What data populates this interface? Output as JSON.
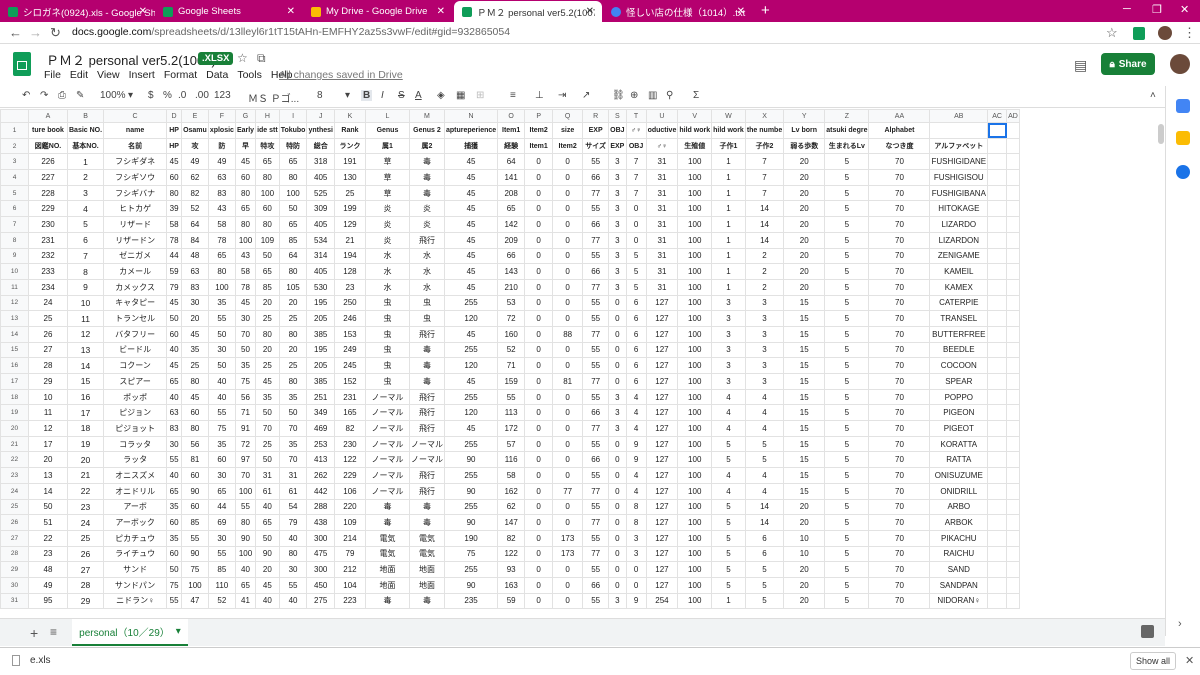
{
  "browser": {
    "tabs": [
      {
        "title": "シロガネ(0924).xls - Google Sheets",
        "fav": "#0f9d58"
      },
      {
        "title": "Google Sheets",
        "fav": "#0f9d58"
      },
      {
        "title": "My Drive - Google Drive",
        "fav": "#fbbc04"
      },
      {
        "title": "ＰＭ２ personal ver5.2(1007).xlsx",
        "fav": "#0f9d58"
      },
      {
        "title": "怪しい店の仕様（1014）.txt",
        "fav": "#4285f4"
      }
    ],
    "url_host": "docs.google.com",
    "url_path": "/spreadsheets/d/13lleyl6r1tT15tAHn-EMFHY2az5s3vwF/edit#gid=932865054"
  },
  "doc": {
    "title": "ＰＭ２ personal ver5.2(1007)",
    "badge": ".XLSX",
    "menu": [
      "File",
      "Edit",
      "View",
      "Insert",
      "Format",
      "Data",
      "Tools",
      "Help"
    ],
    "saved": "All changes saved in Drive",
    "share": "Share"
  },
  "toolbar": {
    "zoom": "100%",
    "currency": "$",
    "percent": "%",
    "dec_less": ".0",
    "dec_more": ".00",
    "format": "123",
    "font": "ＭＳ Ｐゴ...",
    "size": "8",
    "bold": "B",
    "italic": "I",
    "strike": "S",
    "textcolor": "A"
  },
  "grid": {
    "columns": [
      "A",
      "B",
      "C",
      "D",
      "E",
      "F",
      "G",
      "H",
      "I",
      "J",
      "K",
      "L",
      "M",
      "N",
      "O",
      "P",
      "Q",
      "R",
      "S",
      "T",
      "U",
      "V",
      "W",
      "X",
      "Y",
      "Z",
      "AA",
      "AB",
      "AC",
      "AD"
    ],
    "header1": [
      "ture book",
      "Basic NO.",
      "name",
      "HP",
      "Osamu",
      "xplosic",
      "Early",
      "ide stt",
      "Tokubo",
      "ynthesi",
      "Rank",
      "Genus",
      "Genus 2",
      "aptureperience",
      "Item1",
      "Item2",
      "size",
      "EXP",
      "OBJ",
      "♂♀",
      "oductive",
      "hild work",
      "hild work",
      "the numbe",
      "Lv born",
      "atsuki degre",
      "Alphabet",
      "",
      ""
    ],
    "header2": [
      "図鑑NO.",
      "基本NO.",
      "名前",
      "HP",
      "攻",
      "防",
      "早",
      "特攻",
      "特防",
      "総合",
      "ランク",
      "属1",
      "属2",
      "捕獲",
      "経験",
      "Item1",
      "Item2",
      "サイズ",
      "EXP",
      "OBJ",
      "♂♀",
      "生殖値",
      "子作1",
      "子作2",
      "弱る歩数",
      "生まれるLv",
      "なつき度",
      "アルファベット",
      "",
      ""
    ],
    "rows": [
      [
        "226",
        "1",
        "フシギダネ",
        "45",
        "49",
        "49",
        "45",
        "65",
        "65",
        "318",
        "191",
        "草",
        "毒",
        "45",
        "64",
        "0",
        "0",
        "55",
        "3",
        "7",
        "31",
        "100",
        "1",
        "7",
        "20",
        "5",
        "70",
        "FUSHIGIDANE",
        "",
        ""
      ],
      [
        "227",
        "2",
        "フシギソウ",
        "60",
        "62",
        "63",
        "60",
        "80",
        "80",
        "405",
        "130",
        "草",
        "毒",
        "45",
        "141",
        "0",
        "0",
        "66",
        "3",
        "7",
        "31",
        "100",
        "1",
        "7",
        "20",
        "5",
        "70",
        "FUSHIGISOU",
        "",
        ""
      ],
      [
        "228",
        "3",
        "フシギバナ",
        "80",
        "82",
        "83",
        "80",
        "100",
        "100",
        "525",
        "25",
        "草",
        "毒",
        "45",
        "208",
        "0",
        "0",
        "77",
        "3",
        "7",
        "31",
        "100",
        "1",
        "7",
        "20",
        "5",
        "70",
        "FUSHIGIBANA",
        "",
        ""
      ],
      [
        "229",
        "4",
        "ヒトカゲ",
        "39",
        "52",
        "43",
        "65",
        "60",
        "50",
        "309",
        "199",
        "炎",
        "炎",
        "45",
        "65",
        "0",
        "0",
        "55",
        "3",
        "0",
        "31",
        "100",
        "1",
        "14",
        "20",
        "5",
        "70",
        "HITOKAGE",
        "",
        ""
      ],
      [
        "230",
        "5",
        "リザード",
        "58",
        "64",
        "58",
        "80",
        "80",
        "65",
        "405",
        "129",
        "炎",
        "炎",
        "45",
        "142",
        "0",
        "0",
        "66",
        "3",
        "0",
        "31",
        "100",
        "1",
        "14",
        "20",
        "5",
        "70",
        "LIZARDO",
        "",
        ""
      ],
      [
        "231",
        "6",
        "リザードン",
        "78",
        "84",
        "78",
        "100",
        "109",
        "85",
        "534",
        "21",
        "炎",
        "飛行",
        "45",
        "209",
        "0",
        "0",
        "77",
        "3",
        "0",
        "31",
        "100",
        "1",
        "14",
        "20",
        "5",
        "70",
        "LIZARDON",
        "",
        ""
      ],
      [
        "232",
        "7",
        "ゼニガメ",
        "44",
        "48",
        "65",
        "43",
        "50",
        "64",
        "314",
        "194",
        "水",
        "水",
        "45",
        "66",
        "0",
        "0",
        "55",
        "3",
        "5",
        "31",
        "100",
        "1",
        "2",
        "20",
        "5",
        "70",
        "ZENIGAME",
        "",
        ""
      ],
      [
        "233",
        "8",
        "カメール",
        "59",
        "63",
        "80",
        "58",
        "65",
        "80",
        "405",
        "128",
        "水",
        "水",
        "45",
        "143",
        "0",
        "0",
        "66",
        "3",
        "5",
        "31",
        "100",
        "1",
        "2",
        "20",
        "5",
        "70",
        "KAMEIL",
        "",
        ""
      ],
      [
        "234",
        "9",
        "カメックス",
        "79",
        "83",
        "100",
        "78",
        "85",
        "105",
        "530",
        "23",
        "水",
        "水",
        "45",
        "210",
        "0",
        "0",
        "77",
        "3",
        "5",
        "31",
        "100",
        "1",
        "2",
        "20",
        "5",
        "70",
        "KAMEX",
        "",
        ""
      ],
      [
        "24",
        "10",
        "キャタピー",
        "45",
        "30",
        "35",
        "45",
        "20",
        "20",
        "195",
        "250",
        "虫",
        "虫",
        "255",
        "53",
        "0",
        "0",
        "55",
        "0",
        "6",
        "127",
        "100",
        "3",
        "3",
        "15",
        "5",
        "70",
        "CATERPIE",
        "",
        ""
      ],
      [
        "25",
        "11",
        "トランセル",
        "50",
        "20",
        "55",
        "30",
        "25",
        "25",
        "205",
        "246",
        "虫",
        "虫",
        "120",
        "72",
        "0",
        "0",
        "55",
        "0",
        "6",
        "127",
        "100",
        "3",
        "3",
        "15",
        "5",
        "70",
        "TRANSEL",
        "",
        ""
      ],
      [
        "26",
        "12",
        "バタフリー",
        "60",
        "45",
        "50",
        "70",
        "80",
        "80",
        "385",
        "153",
        "虫",
        "飛行",
        "45",
        "160",
        "0",
        "88",
        "77",
        "0",
        "6",
        "127",
        "100",
        "3",
        "3",
        "15",
        "5",
        "70",
        "BUTTERFREE",
        "",
        ""
      ],
      [
        "27",
        "13",
        "ビードル",
        "40",
        "35",
        "30",
        "50",
        "20",
        "20",
        "195",
        "249",
        "虫",
        "毒",
        "255",
        "52",
        "0",
        "0",
        "55",
        "0",
        "6",
        "127",
        "100",
        "3",
        "3",
        "15",
        "5",
        "70",
        "BEEDLE",
        "",
        ""
      ],
      [
        "28",
        "14",
        "コクーン",
        "45",
        "25",
        "50",
        "35",
        "25",
        "25",
        "205",
        "245",
        "虫",
        "毒",
        "120",
        "71",
        "0",
        "0",
        "55",
        "0",
        "6",
        "127",
        "100",
        "3",
        "3",
        "15",
        "5",
        "70",
        "COCOON",
        "",
        ""
      ],
      [
        "29",
        "15",
        "スピアー",
        "65",
        "80",
        "40",
        "75",
        "45",
        "80",
        "385",
        "152",
        "虫",
        "毒",
        "45",
        "159",
        "0",
        "81",
        "77",
        "0",
        "6",
        "127",
        "100",
        "3",
        "3",
        "15",
        "5",
        "70",
        "SPEAR",
        "",
        ""
      ],
      [
        "10",
        "16",
        "ポッポ",
        "40",
        "45",
        "40",
        "56",
        "35",
        "35",
        "251",
        "231",
        "ノーマル",
        "飛行",
        "255",
        "55",
        "0",
        "0",
        "55",
        "3",
        "4",
        "127",
        "100",
        "4",
        "4",
        "15",
        "5",
        "70",
        "POPPO",
        "",
        ""
      ],
      [
        "11",
        "17",
        "ピジョン",
        "63",
        "60",
        "55",
        "71",
        "50",
        "50",
        "349",
        "165",
        "ノーマル",
        "飛行",
        "120",
        "113",
        "0",
        "0",
        "66",
        "3",
        "4",
        "127",
        "100",
        "4",
        "4",
        "15",
        "5",
        "70",
        "PIGEON",
        "",
        ""
      ],
      [
        "12",
        "18",
        "ピジョット",
        "83",
        "80",
        "75",
        "91",
        "70",
        "70",
        "469",
        "82",
        "ノーマル",
        "飛行",
        "45",
        "172",
        "0",
        "0",
        "77",
        "3",
        "4",
        "127",
        "100",
        "4",
        "4",
        "15",
        "5",
        "70",
        "PIGEOT",
        "",
        ""
      ],
      [
        "17",
        "19",
        "コラッタ",
        "30",
        "56",
        "35",
        "72",
        "25",
        "35",
        "253",
        "230",
        "ノーマル",
        "ノーマル",
        "255",
        "57",
        "0",
        "0",
        "55",
        "0",
        "9",
        "127",
        "100",
        "5",
        "5",
        "15",
        "5",
        "70",
        "KORATTA",
        "",
        ""
      ],
      [
        "20",
        "20",
        "ラッタ",
        "55",
        "81",
        "60",
        "97",
        "50",
        "70",
        "413",
        "122",
        "ノーマル",
        "ノーマル",
        "90",
        "116",
        "0",
        "0",
        "66",
        "0",
        "9",
        "127",
        "100",
        "5",
        "5",
        "15",
        "5",
        "70",
        "RATTA",
        "",
        ""
      ],
      [
        "13",
        "21",
        "オニスズメ",
        "40",
        "60",
        "30",
        "70",
        "31",
        "31",
        "262",
        "229",
        "ノーマル",
        "飛行",
        "255",
        "58",
        "0",
        "0",
        "55",
        "0",
        "4",
        "127",
        "100",
        "4",
        "4",
        "15",
        "5",
        "70",
        "ONISUZUME",
        "",
        ""
      ],
      [
        "14",
        "22",
        "オニドリル",
        "65",
        "90",
        "65",
        "100",
        "61",
        "61",
        "442",
        "106",
        "ノーマル",
        "飛行",
        "90",
        "162",
        "0",
        "77",
        "77",
        "0",
        "4",
        "127",
        "100",
        "4",
        "4",
        "15",
        "5",
        "70",
        "ONIDRILL",
        "",
        ""
      ],
      [
        "50",
        "23",
        "アーボ",
        "35",
        "60",
        "44",
        "55",
        "40",
        "54",
        "288",
        "220",
        "毒",
        "毒",
        "255",
        "62",
        "0",
        "0",
        "55",
        "0",
        "8",
        "127",
        "100",
        "5",
        "14",
        "20",
        "5",
        "70",
        "ARBO",
        "",
        ""
      ],
      [
        "51",
        "24",
        "アーボック",
        "60",
        "85",
        "69",
        "80",
        "65",
        "79",
        "438",
        "109",
        "毒",
        "毒",
        "90",
        "147",
        "0",
        "0",
        "77",
        "0",
        "8",
        "127",
        "100",
        "5",
        "14",
        "20",
        "5",
        "70",
        "ARBOK",
        "",
        ""
      ],
      [
        "22",
        "25",
        "ピカチュウ",
        "35",
        "55",
        "30",
        "90",
        "50",
        "40",
        "300",
        "214",
        "電気",
        "電気",
        "190",
        "82",
        "0",
        "173",
        "55",
        "0",
        "3",
        "127",
        "100",
        "5",
        "6",
        "10",
        "5",
        "70",
        "PIKACHU",
        "",
        ""
      ],
      [
        "23",
        "26",
        "ライチュウ",
        "60",
        "90",
        "55",
        "100",
        "90",
        "80",
        "475",
        "79",
        "電気",
        "電気",
        "75",
        "122",
        "0",
        "173",
        "77",
        "0",
        "3",
        "127",
        "100",
        "5",
        "6",
        "10",
        "5",
        "70",
        "RAICHU",
        "",
        ""
      ],
      [
        "48",
        "27",
        "サンド",
        "50",
        "75",
        "85",
        "40",
        "20",
        "30",
        "300",
        "212",
        "地面",
        "地面",
        "255",
        "93",
        "0",
        "0",
        "55",
        "0",
        "0",
        "127",
        "100",
        "5",
        "5",
        "20",
        "5",
        "70",
        "SAND",
        "",
        ""
      ],
      [
        "49",
        "28",
        "サンドパン",
        "75",
        "100",
        "110",
        "65",
        "45",
        "55",
        "450",
        "104",
        "地面",
        "地面",
        "90",
        "163",
        "0",
        "0",
        "66",
        "0",
        "0",
        "127",
        "100",
        "5",
        "5",
        "20",
        "5",
        "70",
        "SANDPAN",
        "",
        ""
      ],
      [
        "95",
        "29",
        "ニドラン♀",
        "55",
        "47",
        "52",
        "41",
        "40",
        "40",
        "275",
        "223",
        "毒",
        "毒",
        "235",
        "59",
        "0",
        "0",
        "55",
        "3",
        "9",
        "254",
        "100",
        "1",
        "5",
        "20",
        "5",
        "70",
        "NIDORAN♀",
        "",
        ""
      ]
    ]
  },
  "sheet_tab": "personal（10／29）",
  "download": {
    "file": "e.xls",
    "show_all": "Show all"
  }
}
